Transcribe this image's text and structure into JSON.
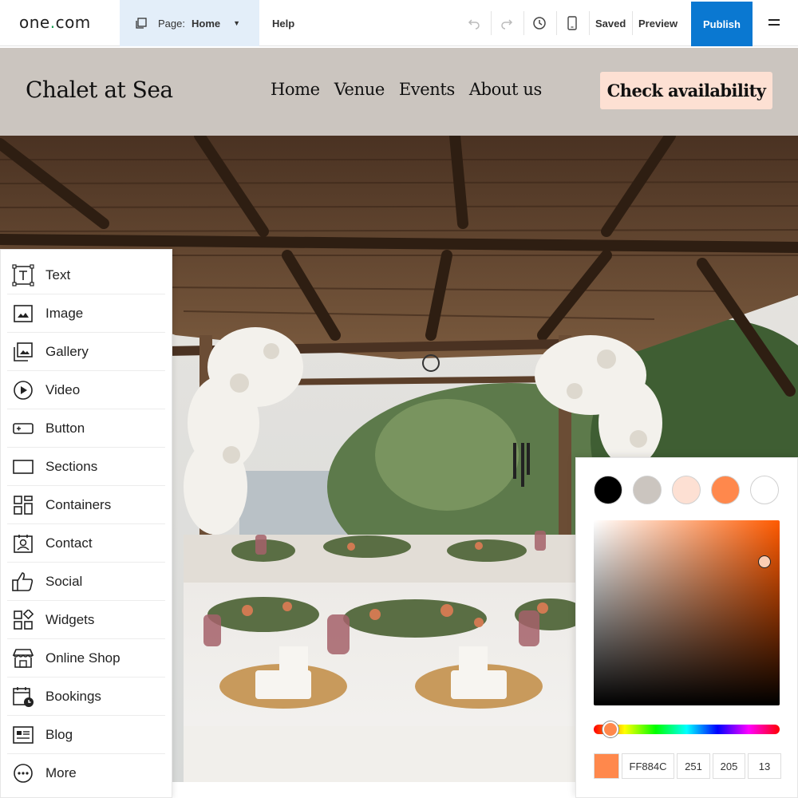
{
  "toolbar": {
    "logo_text": "one",
    "logo_dot": ".",
    "logo_suffix": "com",
    "page_label": "Page:",
    "page_value": "Home",
    "help_label": "Help",
    "saved_label": "Saved",
    "preview_label": "Preview",
    "publish_label": "Publish"
  },
  "site": {
    "title": "Chalet at Sea",
    "nav": [
      "Home",
      "Venue",
      "Events",
      "About us"
    ],
    "cta_label": "Check availability"
  },
  "panel": {
    "items": [
      {
        "label": "Text",
        "icon": "text-icon"
      },
      {
        "label": "Image",
        "icon": "image-icon"
      },
      {
        "label": "Gallery",
        "icon": "gallery-icon"
      },
      {
        "label": "Video",
        "icon": "video-icon"
      },
      {
        "label": "Button",
        "icon": "button-icon"
      },
      {
        "label": "Sections",
        "icon": "sections-icon"
      },
      {
        "label": "Containers",
        "icon": "containers-icon"
      },
      {
        "label": "Contact",
        "icon": "contact-icon"
      },
      {
        "label": "Social",
        "icon": "thumbs-up-icon"
      },
      {
        "label": "Widgets",
        "icon": "widgets-icon"
      },
      {
        "label": "Online Shop",
        "icon": "shop-icon"
      },
      {
        "label": "Bookings",
        "icon": "calendar-clock-icon"
      },
      {
        "label": "Blog",
        "icon": "blog-icon"
      },
      {
        "label": "More",
        "icon": "more-icon"
      }
    ]
  },
  "color_picker": {
    "swatches": [
      "#000000",
      "#cbc5bf",
      "#fde0d3",
      "#ff884c",
      "#ffffff"
    ],
    "hue_color": "#ff5a00",
    "hex": "FF884C",
    "r": "251",
    "g": "205",
    "b": "13",
    "current_color": "#ff884c"
  }
}
